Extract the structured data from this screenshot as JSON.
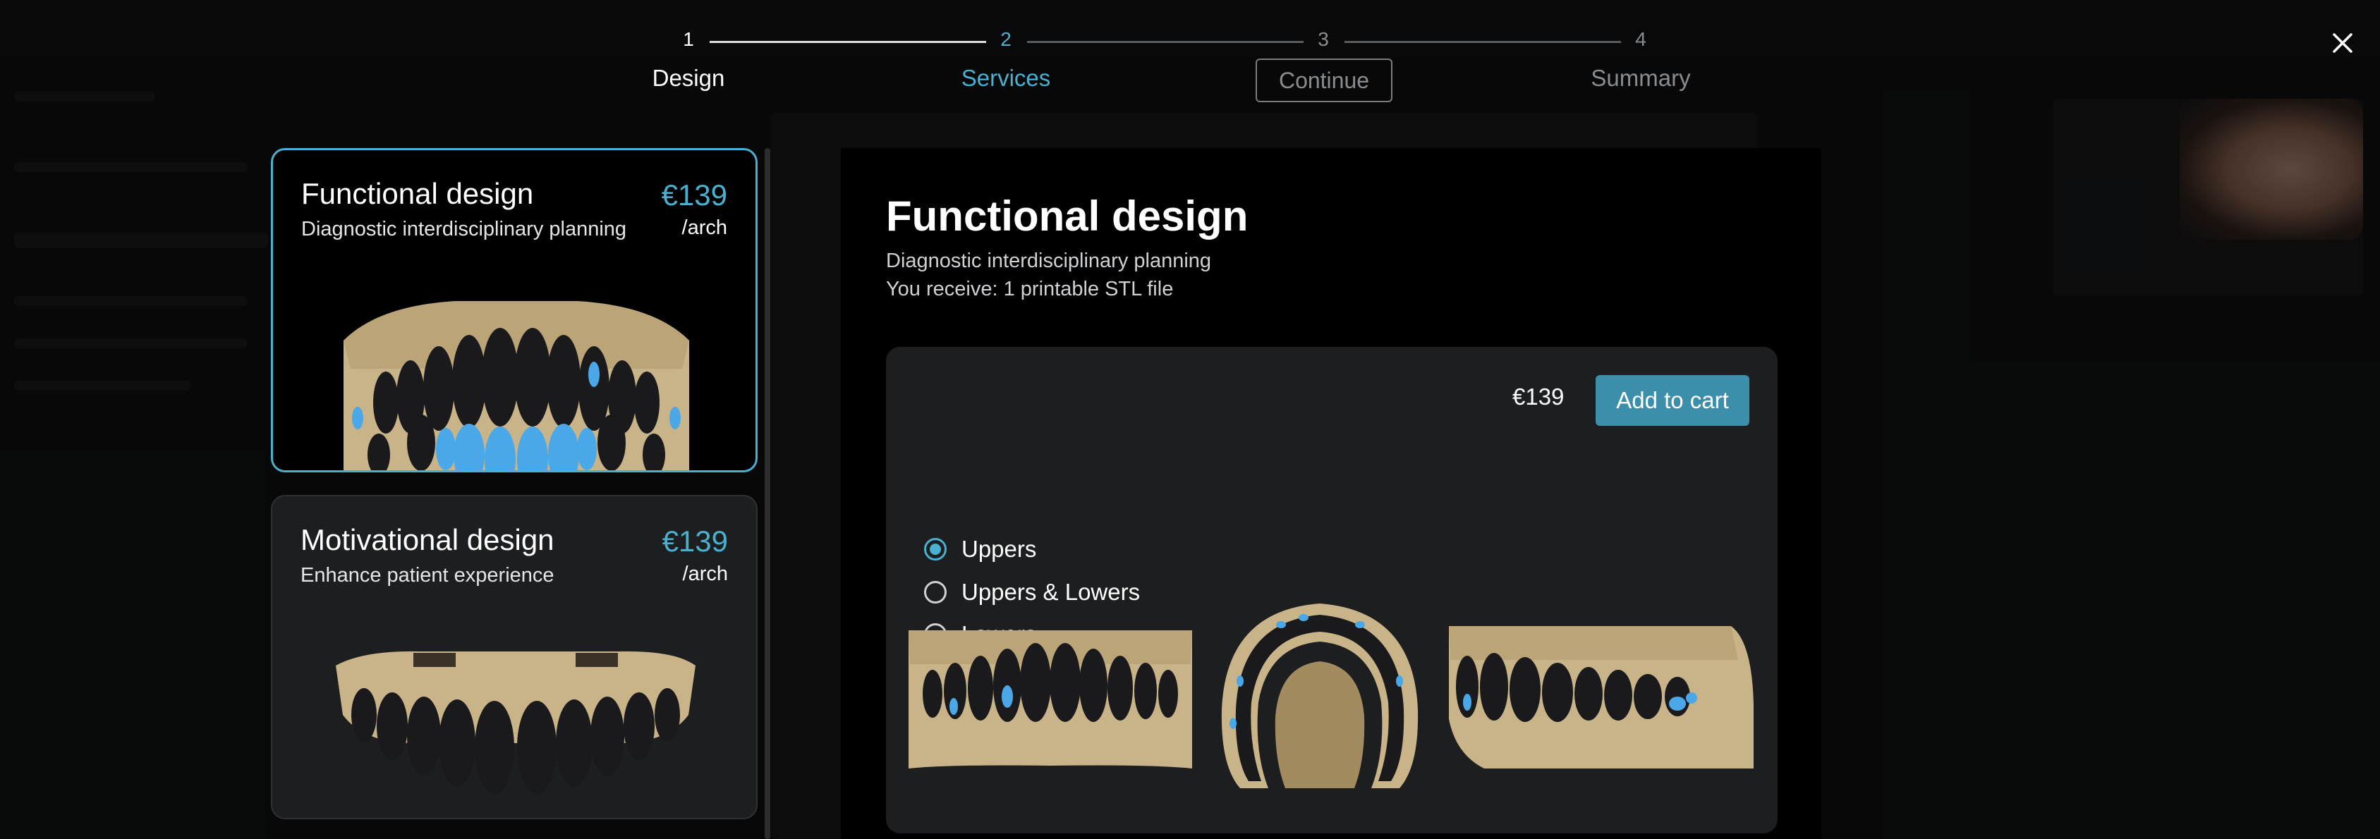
{
  "stepper": {
    "steps": [
      {
        "number": "1",
        "label": "Design",
        "state": "done"
      },
      {
        "number": "2",
        "label": "Services",
        "state": "active"
      },
      {
        "number": "3",
        "label": "",
        "state": "upcoming"
      },
      {
        "number": "4",
        "label": "Summary",
        "state": "upcoming"
      }
    ],
    "continue_label": "Continue",
    "close_icon": "close-icon"
  },
  "designs": [
    {
      "title": "Functional design",
      "subtitle": "Diagnostic interdisciplinary planning",
      "price": "€139",
      "unit": "/arch",
      "selected": true
    },
    {
      "title": "Motivational design",
      "subtitle": "Enhance patient experience",
      "price": "€139",
      "unit": "/arch",
      "selected": false
    }
  ],
  "detail": {
    "title": "Functional design",
    "lines": [
      "Diagnostic interdisciplinary planning",
      "You receive: 1 printable STL file"
    ],
    "options": [
      {
        "label": "Uppers",
        "checked": true
      },
      {
        "label": "Uppers & Lowers",
        "checked": false
      },
      {
        "label": "Lowers",
        "checked": false
      }
    ],
    "price": "€139",
    "add_to_cart_label": "Add to cart"
  },
  "colors": {
    "accent": "#4ab0d0",
    "button": "#3b8faa",
    "card_bg": "#1d1e1f",
    "panel_bg": "#000000",
    "model_gold": "#c9b389",
    "teeth_black": "#1a1a1c",
    "highlight_blue": "#4aa8e8"
  }
}
